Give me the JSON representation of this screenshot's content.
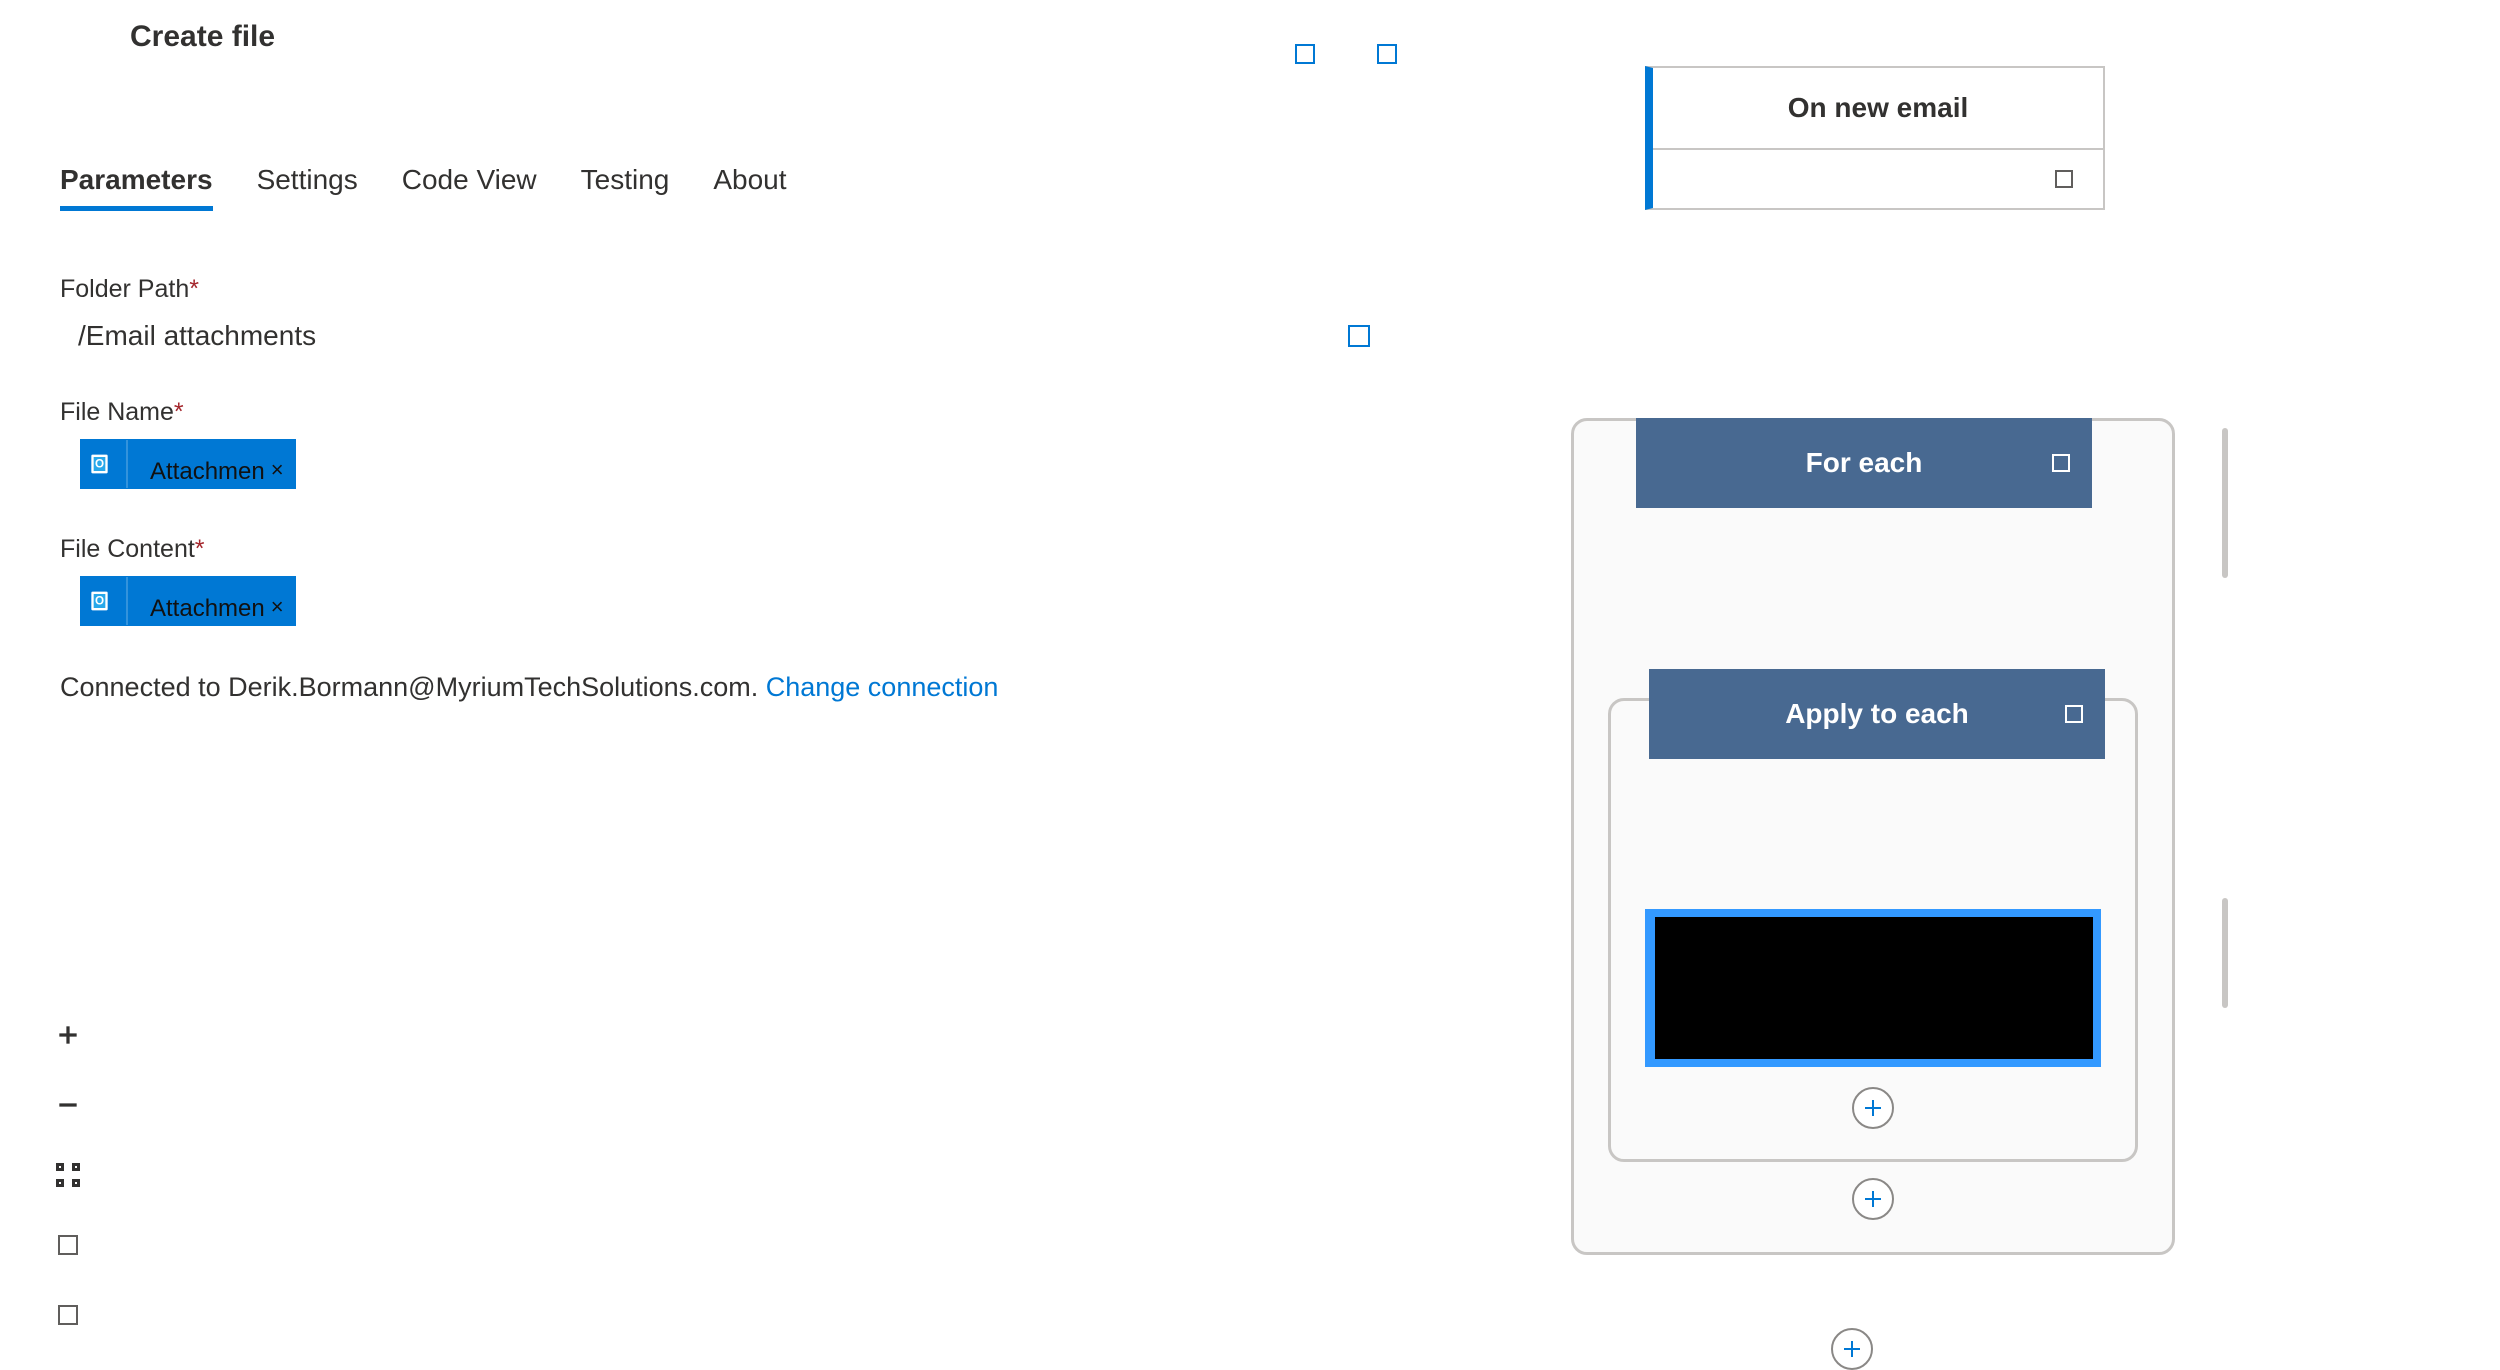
{
  "panel": {
    "title": "Create file",
    "tabs": [
      "Parameters",
      "Settings",
      "Code View",
      "Testing",
      "About"
    ],
    "active_tab": "Parameters",
    "fields": {
      "folder_label": "Folder Path",
      "folder_value": "/Email attachments",
      "filename_label": "File Name",
      "filename_token": "Attachmen",
      "filecontent_label": "File Content",
      "filecontent_token": "Attachmen"
    },
    "connection": {
      "prefix": "Connected to ",
      "email": "Derik.Bormann@MyriumTechSolutions.com",
      "suffix": ".  ",
      "change_link": "Change connection"
    }
  },
  "flow": {
    "trigger_title": "On new email",
    "foreach_title": "For each",
    "apply_title": "Apply to each"
  }
}
